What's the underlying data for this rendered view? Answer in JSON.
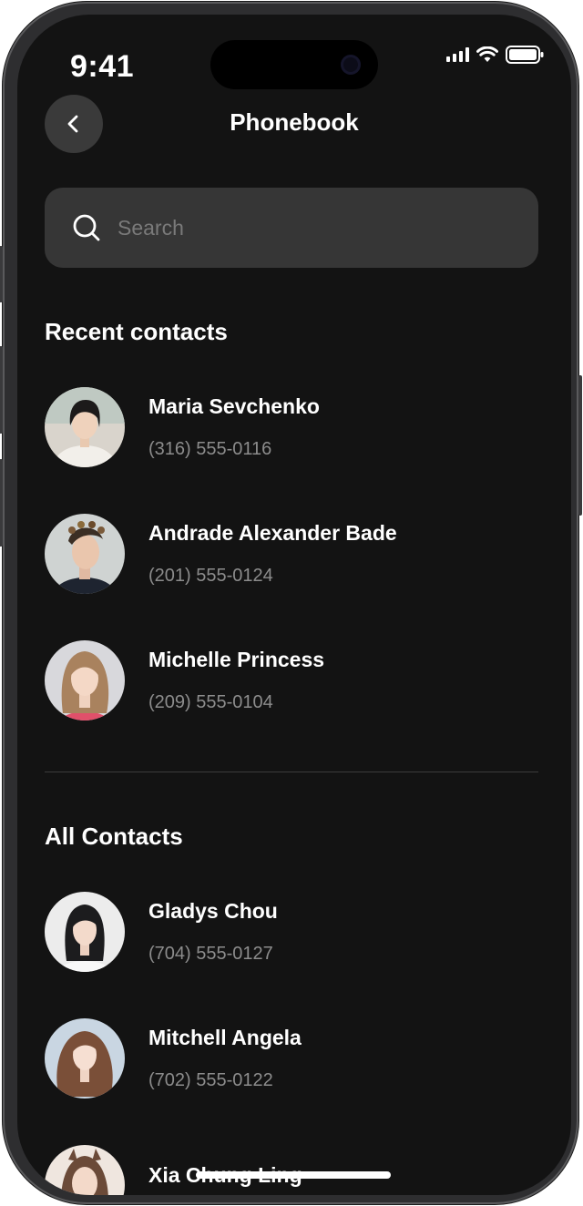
{
  "status_bar": {
    "time": "9:41"
  },
  "header": {
    "title": "Phonebook",
    "back_icon": "chevron-left-icon"
  },
  "search": {
    "placeholder": "Search",
    "value": "",
    "icon": "search-icon"
  },
  "recent": {
    "title": "Recent contacts",
    "items": [
      {
        "name": "Maria Sevchenko",
        "phone": "(316) 555-0116"
      },
      {
        "name": "Andrade Alexander Bade",
        "phone": "(201) 555-0124"
      },
      {
        "name": "Michelle Princess",
        "phone": "(209) 555-0104"
      }
    ]
  },
  "all": {
    "title": "All Contacts",
    "items": [
      {
        "name": "Gladys Chou",
        "phone": "(704) 555-0127"
      },
      {
        "name": "Mitchell Angela",
        "phone": "(702) 555-0122"
      },
      {
        "name": "Xia Chung Ling",
        "phone": ""
      }
    ]
  },
  "colors": {
    "background": "#131313",
    "surface": "#363636",
    "text": "#ffffff",
    "muted": "#8c8c8c"
  }
}
